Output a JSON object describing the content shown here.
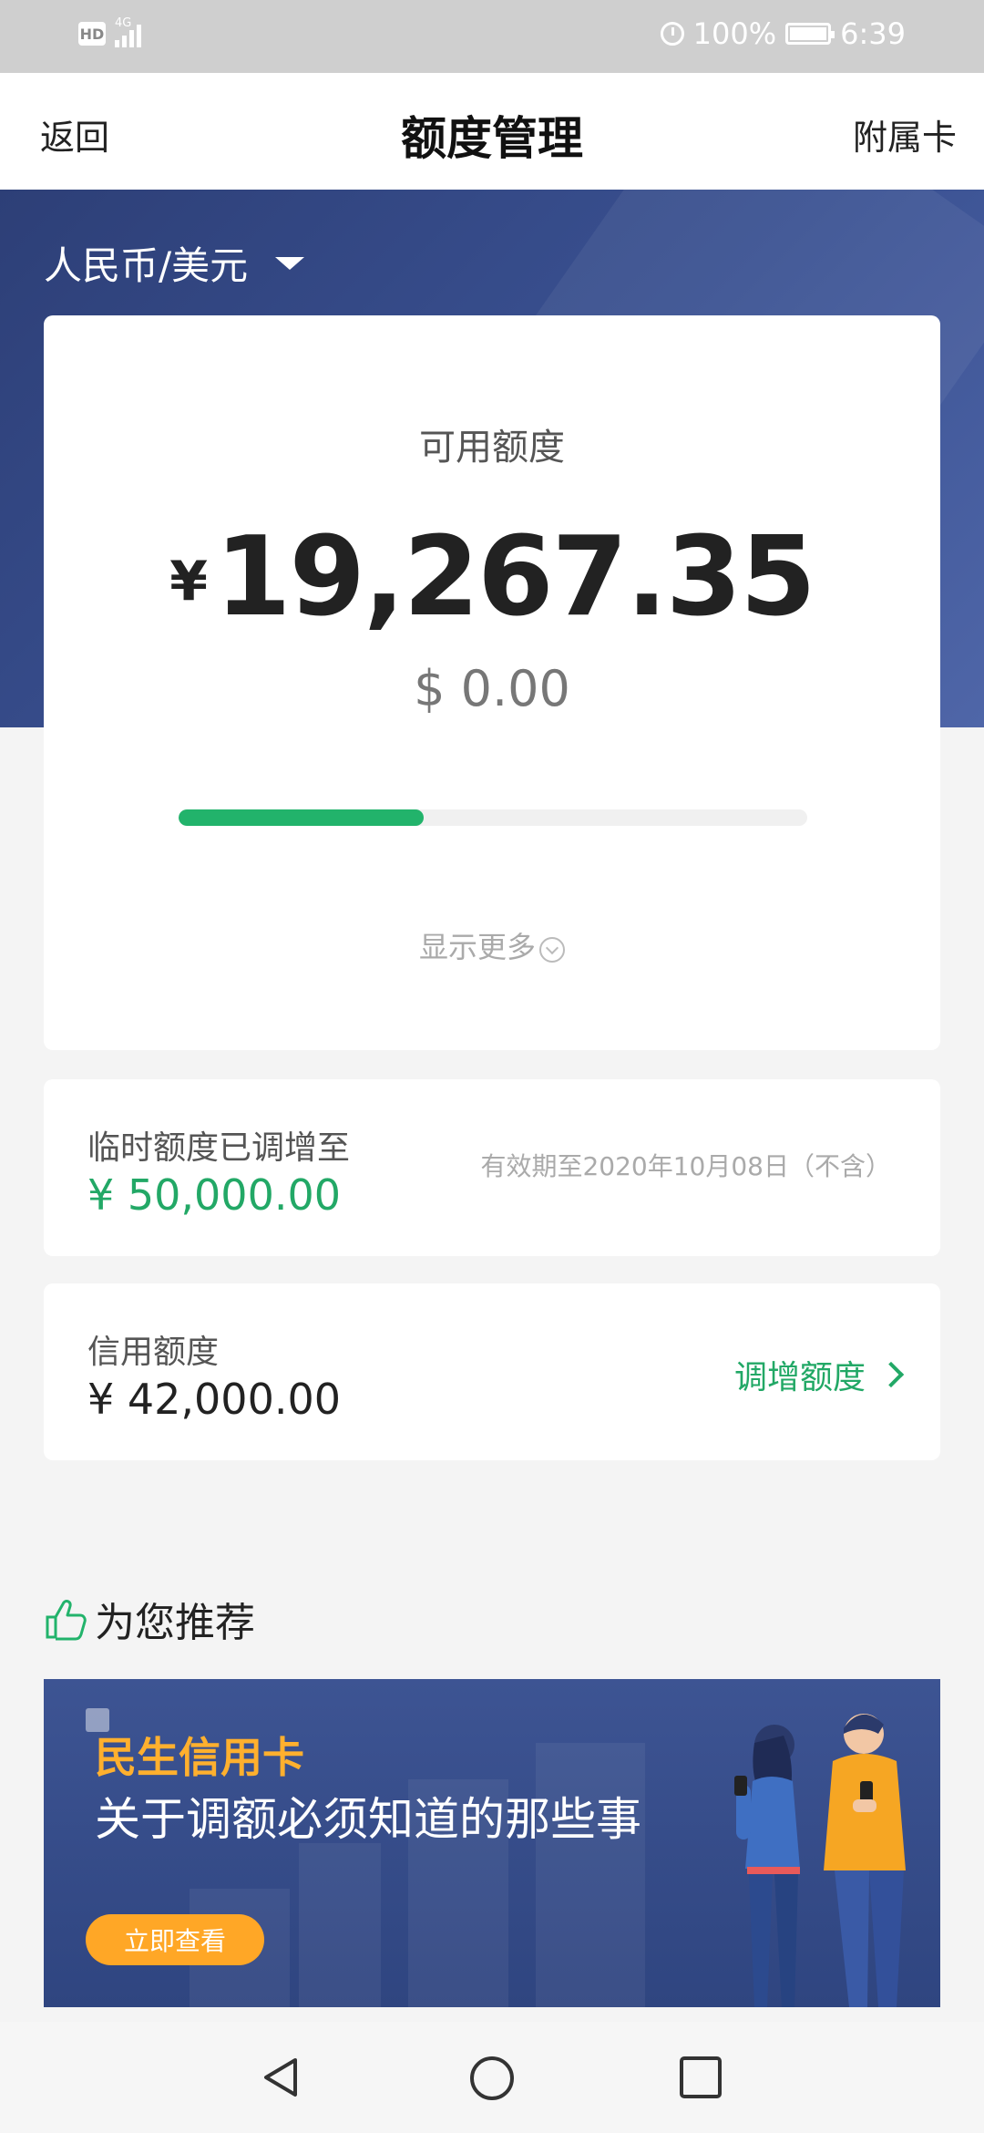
{
  "status_bar": {
    "hd_label": "HD",
    "network": "4G",
    "battery": "100%",
    "time": "6:39"
  },
  "nav": {
    "back_label": "返回",
    "title": "额度管理",
    "right_label": "附属卡"
  },
  "currency_selector": {
    "label": "人民币/美元"
  },
  "available": {
    "label": "可用额度",
    "currency_symbol": "¥",
    "amount": "19,267.35",
    "usd_amount": "$ 0.00",
    "usage_fraction": 0.39,
    "show_more_label": "显示更多"
  },
  "temporary": {
    "title": "临时额度已调增至",
    "amount": "¥ 50,000.00",
    "valid_text": "有效期至2020年10月08日（不含）"
  },
  "credit": {
    "title": "信用额度",
    "amount": "¥ 42,000.00",
    "adjust_label": "调增额度"
  },
  "recommend": {
    "title": "为您推荐",
    "banner": {
      "tag": "民生信用卡",
      "text": "关于调额必须知道的那些事",
      "button_label": "立即查看"
    }
  },
  "colors": {
    "accent_green": "#22b36b",
    "header_blue": "#34498a",
    "banner_orange": "#ffa726"
  }
}
